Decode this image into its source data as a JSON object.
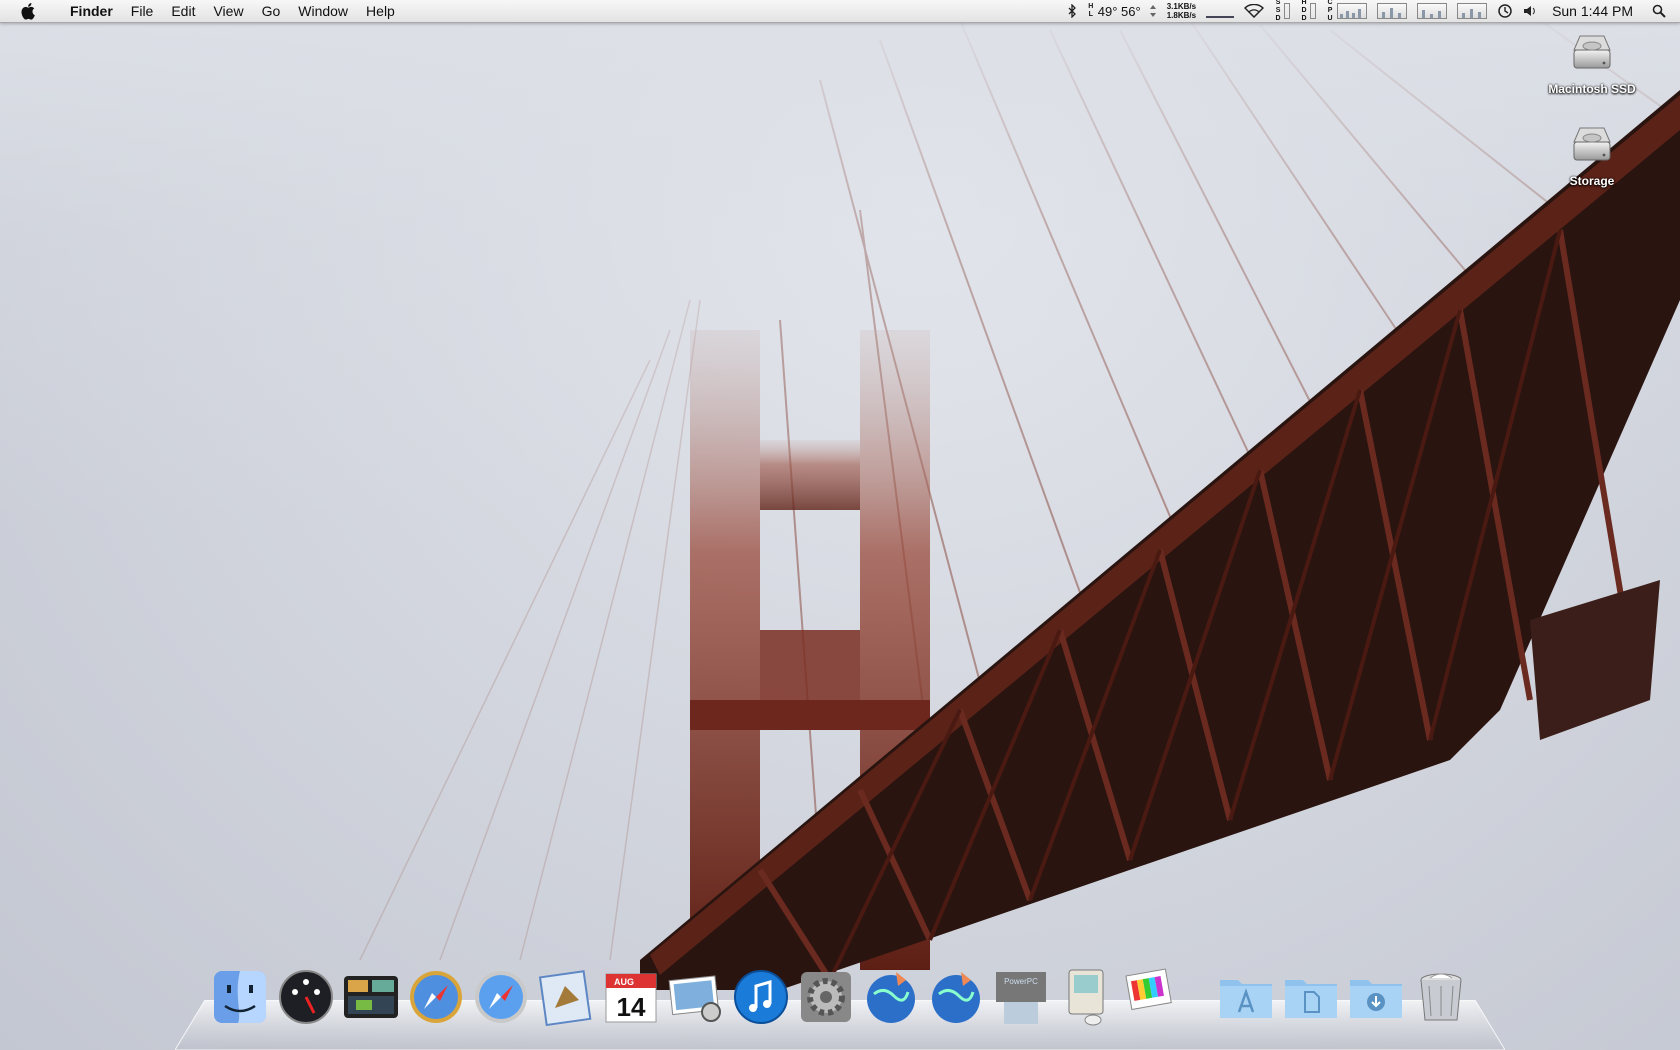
{
  "menubar": {
    "app_name": "Finder",
    "menus": [
      "File",
      "Edit",
      "View",
      "Go",
      "Window",
      "Help"
    ],
    "weather": "49° 56°",
    "net_up": "3.1KB/s",
    "net_down": "1.8KB/s",
    "clock": "Sun 1:44 PM"
  },
  "desktop": {
    "icons": [
      {
        "label": "Macintosh SSD"
      },
      {
        "label": "Storage"
      }
    ]
  },
  "dock": {
    "calendar_month": "AUG",
    "calendar_day": "14",
    "powerpc_label": "PowerPC"
  }
}
